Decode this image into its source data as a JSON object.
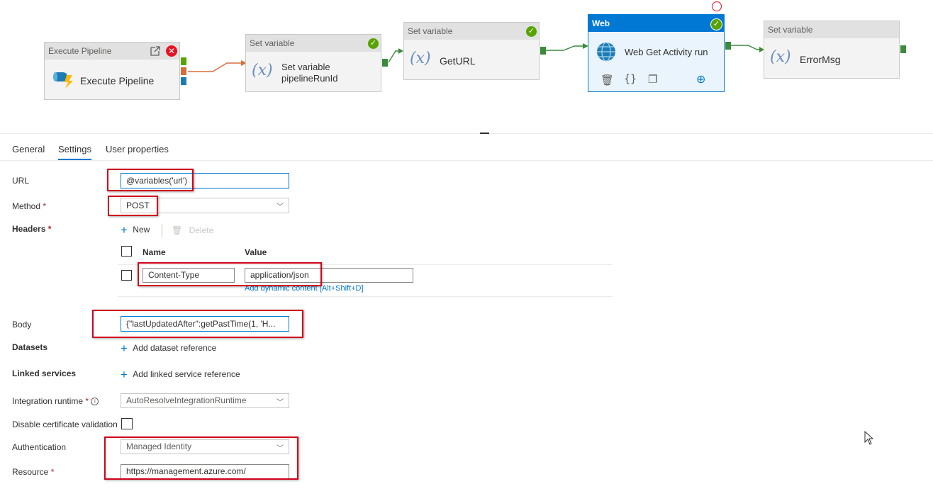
{
  "canvas": {
    "execute_pipeline": {
      "header": "Execute Pipeline",
      "title": "Execute Pipeline"
    },
    "set_variable_1": {
      "header": "Set variable",
      "title_line1": "Set variable",
      "title_line2": "pipelineRunId"
    },
    "set_variable_2": {
      "header": "Set variable",
      "title": "GetURL"
    },
    "web_activity": {
      "header": "Web",
      "title": "Web Get Activity run"
    },
    "set_variable_3": {
      "header": "Set variable",
      "title": "ErrorMsg"
    },
    "colors": {
      "success": "#57a300",
      "failure": "#e81123",
      "completion": "#1e7cb4",
      "web_header": "#0078d4",
      "connector": "#3c8a3c"
    }
  },
  "tabs": [
    {
      "label": "General"
    },
    {
      "label": "Settings"
    },
    {
      "label": "User properties"
    }
  ],
  "settings": {
    "url": {
      "label": "URL",
      "value": "@variables('url')"
    },
    "method": {
      "label": "Method",
      "req": "*",
      "value": "POST"
    },
    "headers": {
      "label": "Headers",
      "req": "*",
      "new_label": "New",
      "delete_label": "Delete",
      "col_name": "Name",
      "col_value": "Value",
      "row": {
        "name": "Content-Type",
        "value": "application/json"
      },
      "dynamic_hint": "Add dynamic content",
      "dynamic_shortcut": "[Alt+Shift+D]"
    },
    "body": {
      "label": "Body",
      "value": "{\"lastUpdatedAfter\":getPastTime(1, 'H..."
    },
    "datasets": {
      "label": "Datasets",
      "action": "Add dataset reference"
    },
    "linked_services": {
      "label": "Linked services",
      "action": "Add linked service reference"
    },
    "integration_runtime": {
      "label": "Integration runtime",
      "req": "*",
      "value": "AutoResolveIntegrationRuntime"
    },
    "disable_cert": {
      "label": "Disable certificate validation"
    },
    "authentication": {
      "label": "Authentication",
      "value": "Managed Identity"
    },
    "resource": {
      "label": "Resource",
      "req": "*",
      "value": "https://management.azure.com/"
    }
  }
}
